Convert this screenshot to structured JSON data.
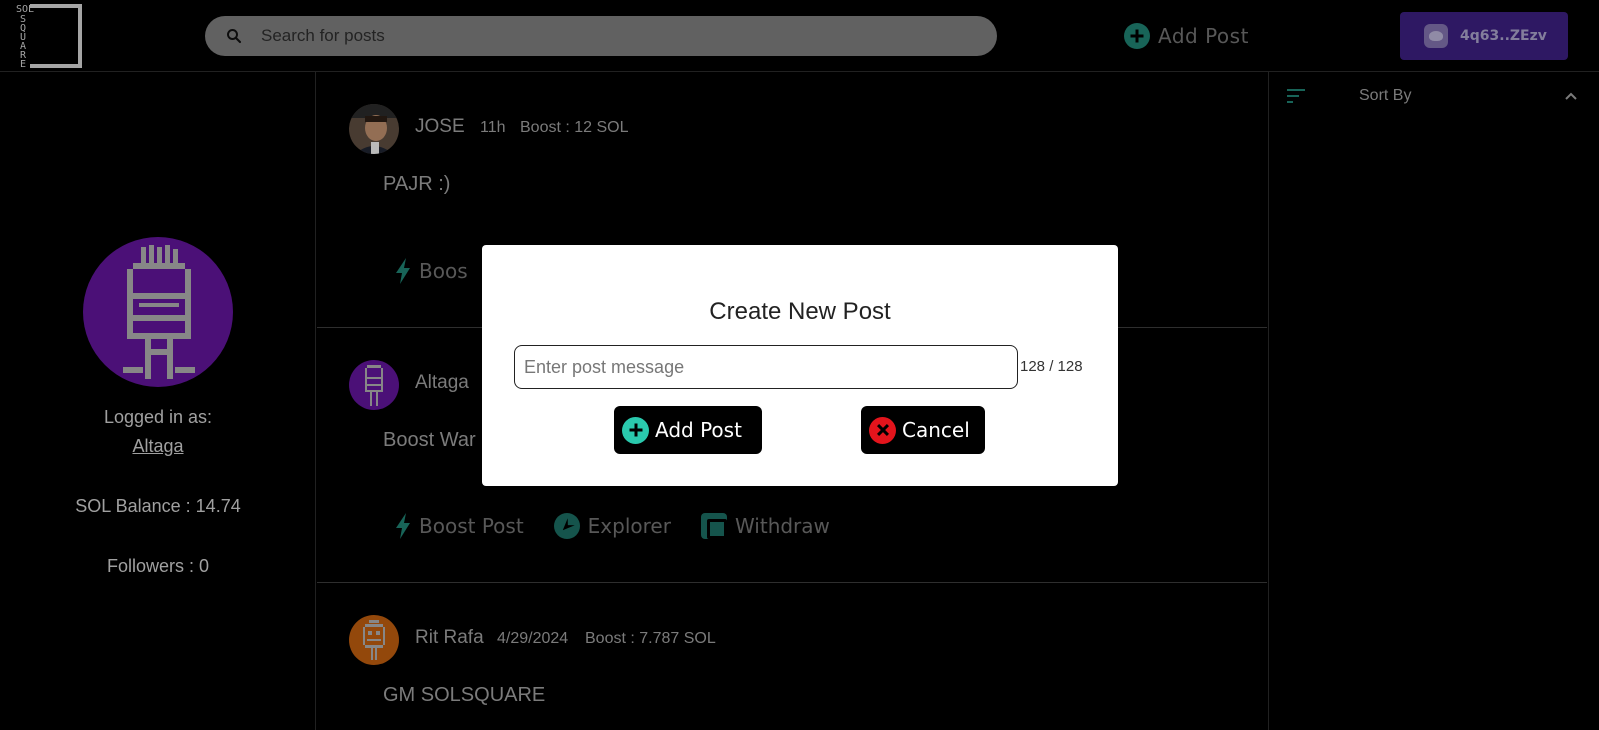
{
  "header": {
    "logo_text": "SOLSQUARE",
    "logo_letters": [
      "S",
      "Q",
      "U",
      "A",
      "R",
      "E"
    ],
    "logo_prefix": "SOL",
    "search": {
      "placeholder": "Search for posts",
      "value": ""
    },
    "add_post_label": "Add Post",
    "wallet_label": "4q63..ZEzv"
  },
  "profile": {
    "logged_in_label": "Logged in as:",
    "username": "Altaga",
    "balance_label": "SOL Balance : 14.74",
    "followers_label": "Followers : 0"
  },
  "posts": [
    {
      "author": "JOSE",
      "time": "11h",
      "boost": "Boost : 12 SOL",
      "message": "PAJR :)",
      "avatar": "photo"
    },
    {
      "author": "Altaga",
      "time": "",
      "boost": "",
      "message": "Boost War",
      "avatar": "robot-purple"
    },
    {
      "author": "Rit Rafa",
      "time": "4/29/2024",
      "boost": "Boost : 7.787 SOL",
      "message": "GM SOLSQUARE",
      "avatar": "robot-orange"
    }
  ],
  "post_actions": {
    "boost_label": "Boost Post",
    "boost_label_partial": "Boos",
    "explorer_label": "Explorer",
    "withdraw_label": "Withdraw"
  },
  "sidebar": {
    "sort_label": "Sort By"
  },
  "modal": {
    "title": "Create New Post",
    "input_placeholder": "Enter post message",
    "input_value": "",
    "counter": "128 / 128",
    "add_label": "Add Post",
    "cancel_label": "Cancel"
  },
  "colors": {
    "accent_teal": "#1f7d6f",
    "wallet_purple": "#3a1f7c",
    "avatar_purple": "#5e1595",
    "cancel_red": "#e3141c",
    "add_teal": "#2ac9ad"
  }
}
